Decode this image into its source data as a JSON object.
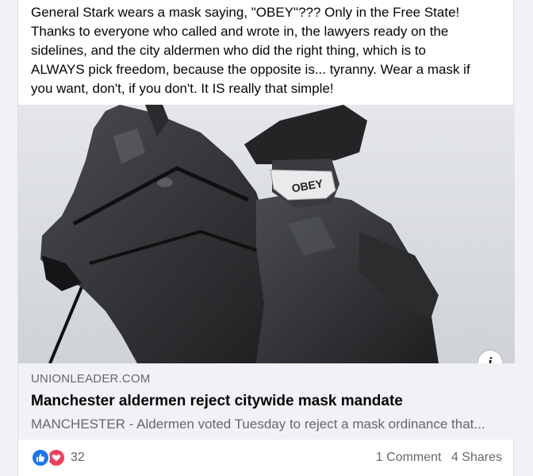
{
  "post": {
    "text_lines": [
      "General Stark wears a mask saying, \"OBEY\"??? Only in the Free State!",
      "Thanks to everyone who called and wrote in, the lawyers ready on the",
      "sidelines, and the city aldermen who did the right thing, which is to",
      "ALWAYS pick freedom, because the opposite is... tyranny. Wear a mask if",
      "you want, don't, if you don't. It IS really that simple!"
    ]
  },
  "media": {
    "mask_text": "OBEY",
    "info_icon": "info-icon",
    "info_glyph": "i"
  },
  "link_preview": {
    "domain": "UNIONLEADER.COM",
    "title": "Manchester aldermen reject citywide mask mandate",
    "description": "MANCHESTER - Aldermen voted Tuesday to reject a mask ordinance that..."
  },
  "footer": {
    "reaction_icons": [
      "like-icon",
      "love-icon"
    ],
    "reaction_count": "32",
    "comments": "1 Comment",
    "shares": "4 Shares"
  },
  "colors": {
    "like": "#1877f2",
    "love": "#f33e58",
    "secondary_text": "#65676b",
    "preview_bg": "#f0f2f5"
  }
}
